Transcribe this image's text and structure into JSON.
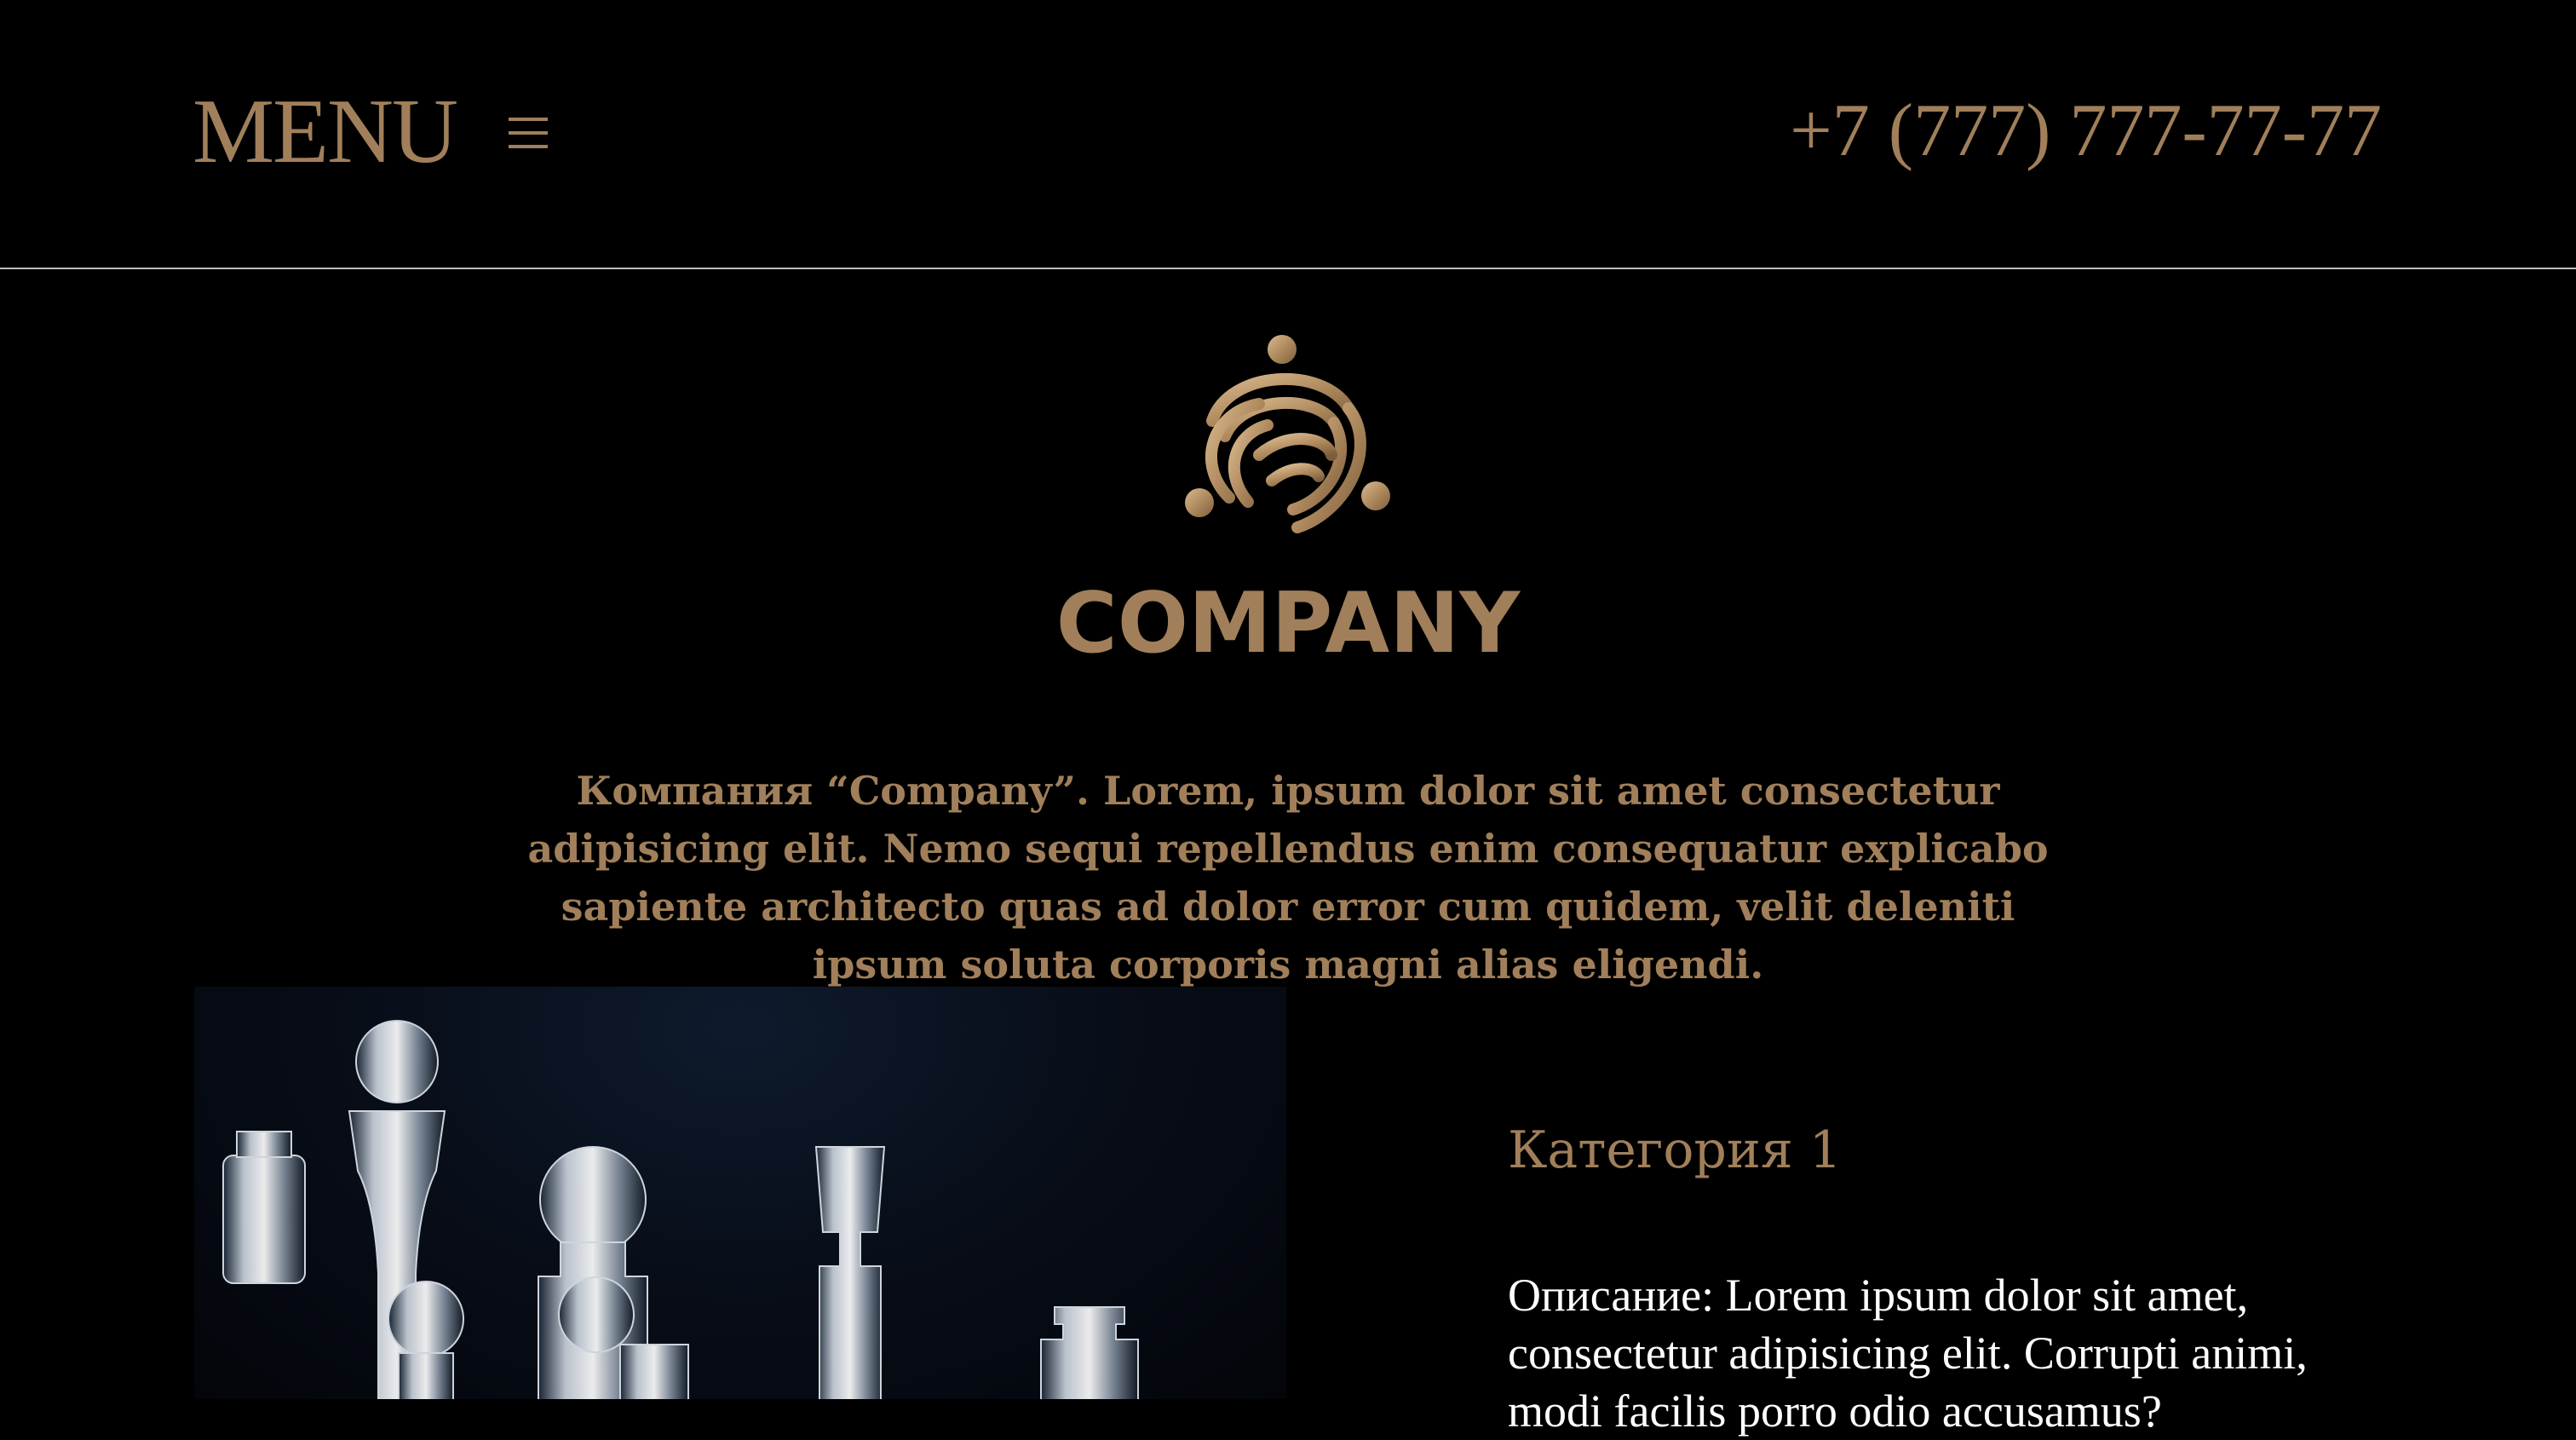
{
  "header": {
    "menu_label": "MENU",
    "phone": "+7 (777) 777-77-77"
  },
  "brand": {
    "name": "COMPANY",
    "description": "Компания “Company”. Lorem, ipsum dolor sit amet consectetur adipisicing elit. Nemo sequi repellendus enim consequatur explicabo sapiente architecto quas ad dolor error cum quidem, velit deleniti ipsum soluta corporis magni alias eligendi."
  },
  "category": {
    "title": "Категория 1",
    "description": "Описание: Lorem ipsum dolor sit amet, consectetur adipisicing elit. Corrupti animi, modi facilis porro odio accusamus?"
  },
  "colors": {
    "background": "#000000",
    "accent_gold": "#a07f5a",
    "divider": "#bdbdbd",
    "text_white": "#ffffff"
  },
  "icons": {
    "menu": "hamburger-icon",
    "logo": "company-logo-knot"
  }
}
